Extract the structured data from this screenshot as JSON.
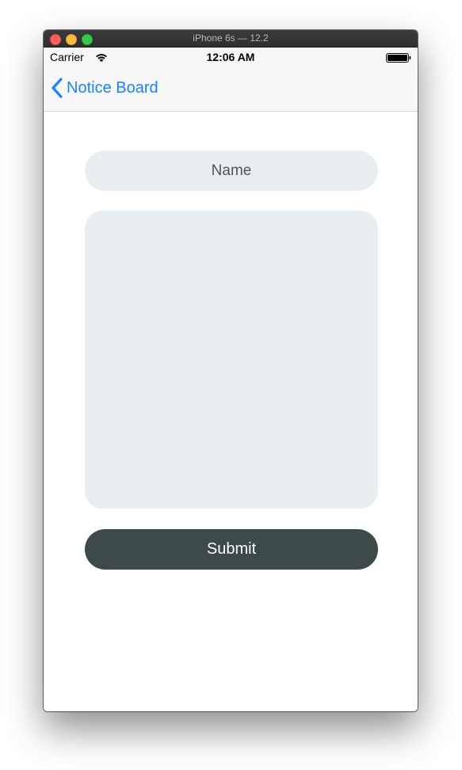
{
  "window": {
    "title": "iPhone 6s — 12.2"
  },
  "status_bar": {
    "carrier": "Carrier",
    "time": "12:06 AM",
    "wifi_icon": "wifi-icon",
    "battery_icon": "battery-icon"
  },
  "nav": {
    "back_label": "Notice Board",
    "back_icon": "chevron-left-icon"
  },
  "form": {
    "name_placeholder": "Name",
    "name_value": "",
    "message_value": "",
    "submit_label": "Submit"
  },
  "colors": {
    "accent": "#1a82fb",
    "field_background": "#e9eef2",
    "button_background": "#3e4a4a"
  }
}
